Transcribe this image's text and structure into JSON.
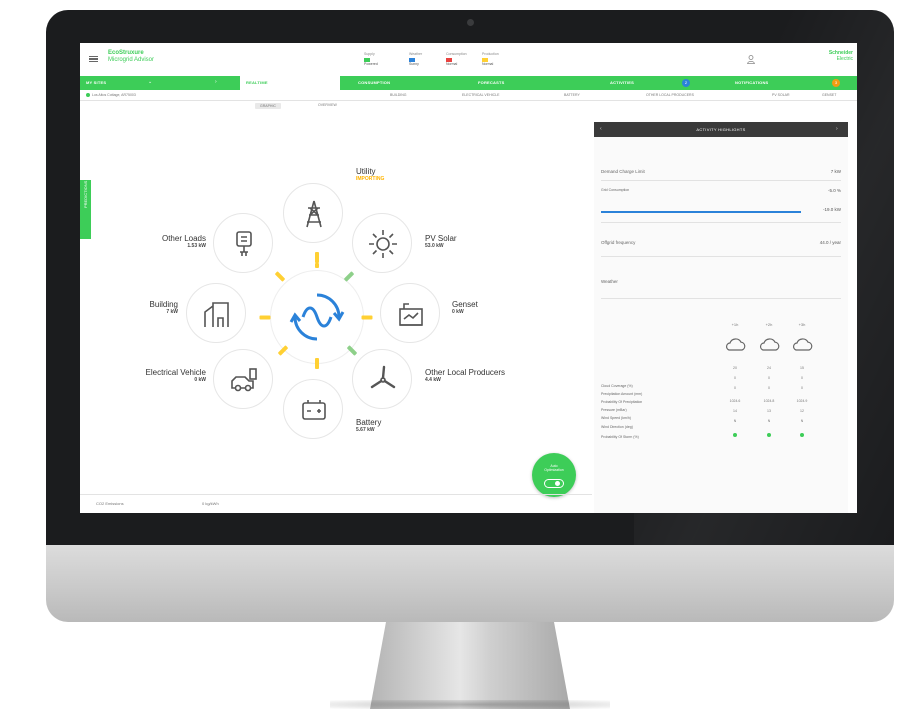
{
  "app": {
    "brand_line1": "EcoStruxure",
    "brand_line2": "Microgrid Advisor",
    "logo_line1": "Schneider",
    "logo_line2": "Electric"
  },
  "header_stats": [
    {
      "label": "Supply",
      "value": "Powered",
      "color": "#3dcd58"
    },
    {
      "label": "Weather",
      "value": "Sunny",
      "color": "#2b82d9"
    },
    {
      "label": "Consumption",
      "value": "Normal",
      "color": "#e8423f"
    },
    {
      "label": "Production",
      "value": "Normal",
      "color": "#ffd033"
    }
  ],
  "nav": {
    "items": [
      "MY SITES",
      "REALTIME",
      "CONSUMPTION",
      "FORECASTS",
      "ACTIVITIES",
      "NOTIFICATIONS"
    ],
    "activities_badge": "2",
    "notifications_badge": "3",
    "colors": {
      "green": "#3dcd58",
      "blue": "#2b82d9",
      "orange": "#f39c12"
    }
  },
  "subnav": {
    "site": "Los Altos Cottage, AR75003",
    "items": [
      "BUILDING",
      "ELECTRICAL VEHICLE",
      "BATTERY",
      "OTHER LOCAL PRODUCERS",
      "PV SOLAR",
      "GENSET"
    ],
    "subtabs": [
      "GRAPHIC",
      "OVERVIEW"
    ]
  },
  "side_tab": "PREDICTIONS",
  "energy": {
    "utility": {
      "label": "Utility",
      "value": "IMPORTING"
    },
    "pv_solar": {
      "label": "PV Solar",
      "value": "53.0 kW"
    },
    "genset": {
      "label": "Genset",
      "value": "0 kW"
    },
    "other_local": {
      "label": "Other Local Producers",
      "value": "4.4 kW"
    },
    "battery": {
      "label": "Battery",
      "value": "5.67 kW"
    },
    "ev": {
      "label": "Electrical Vehicle",
      "value": "0 kW"
    },
    "building": {
      "label": "Building",
      "value": "7 kW"
    },
    "other_loads": {
      "label": "Other Loads",
      "value": "1.53 kW"
    }
  },
  "fab": {
    "label_line1": "Auto",
    "label_line2": "Optimization"
  },
  "footer": {
    "left": "CO2 Emissions",
    "right": "0 kg/kWh"
  },
  "panel": {
    "title": "ACTIVITY HIGHLIGHTS",
    "demand_charge": {
      "label": "Demand Charge Limit",
      "value": "7 kW"
    },
    "grid_consumption": {
      "label": "Grid Consumption",
      "value": "-5.0 %",
      "bar_value": "-19.0 kW"
    },
    "offgrid": {
      "label": "Offgrid frequency",
      "value": "44.0 / year"
    },
    "weather": {
      "title": "Weather",
      "hours": [
        "+1h",
        "+2h",
        "+3h"
      ],
      "rows": [
        {
          "label": "Cloud Coverage (%)",
          "values": [
            "20",
            "24",
            "15"
          ]
        },
        {
          "label": "Precipitation Amount (mm)",
          "values": [
            "0",
            "0",
            "0"
          ]
        },
        {
          "label": "Probability Of Precipitation",
          "values": [
            "0",
            "0",
            "0"
          ]
        },
        {
          "label": "Pressure (mBar)",
          "values": [
            "1024.6",
            "1024.8",
            "1024.9"
          ]
        },
        {
          "label": "Wind Speed (km/h)",
          "values": [
            "14",
            "13",
            "12"
          ]
        },
        {
          "label": "Wind Direction (deg)",
          "values": [
            "N",
            "N",
            "N"
          ]
        },
        {
          "label": "Probability Of Storm (%)",
          "values": [
            "",
            "",
            ""
          ]
        }
      ]
    }
  }
}
